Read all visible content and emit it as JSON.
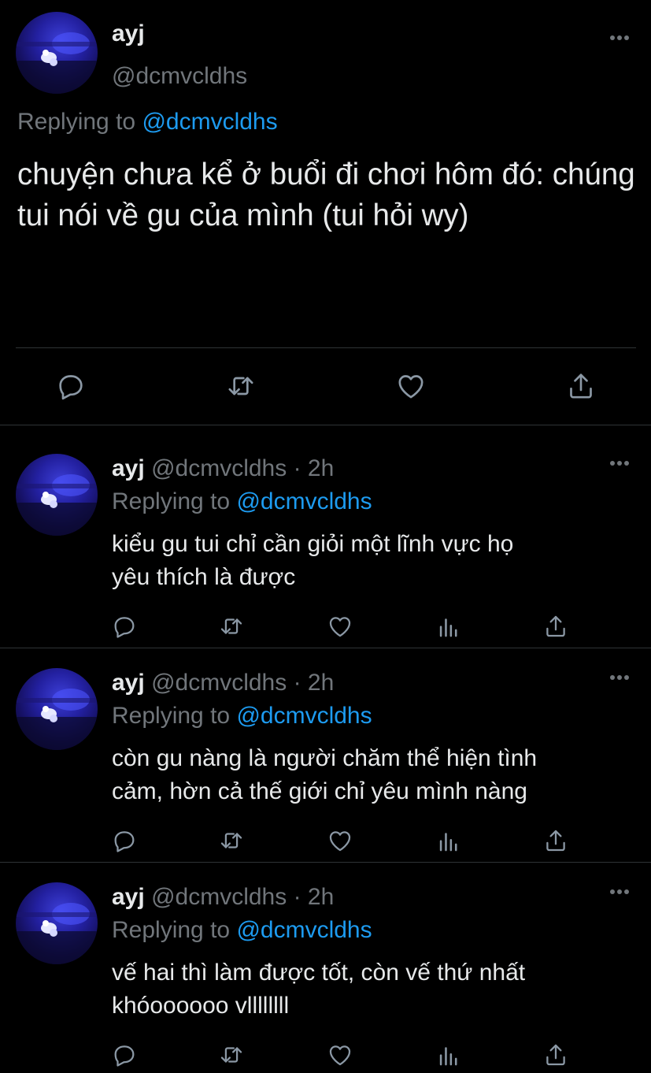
{
  "colors": {
    "background": "#000000",
    "text": "#e7e9ea",
    "muted": "#71767b",
    "accent": "#1d9bf0",
    "divider": "#2f3336"
  },
  "main_tweet": {
    "name": "ayj",
    "handle": "@dcmvcldhs",
    "replying_prefix": "Replying to",
    "replying_mention": "@dcmvcldhs",
    "text": "chuyện chưa kể ở buổi đi chơi hôm đó: chúng tui nói về gu của mình (tui hỏi wy)",
    "actions": [
      "reply-icon",
      "retweet-icon",
      "like-icon",
      "share-icon"
    ]
  },
  "replies": [
    {
      "name": "ayj",
      "handle": "@dcmvcldhs",
      "time": "· 2h",
      "replying_prefix": "Replying to",
      "replying_mention": "@dcmvcldhs",
      "text_line1": "kiểu gu tui chỉ cần giỏi một lĩnh vực họ",
      "text_line2": "yêu thích là được"
    },
    {
      "name": "ayj",
      "handle": "@dcmvcldhs",
      "time": "· 2h",
      "replying_prefix": "Replying to",
      "replying_mention": "@dcmvcldhs",
      "text_line1": "còn gu nàng là người chăm thể hiện tình",
      "text_line2": "cảm, hờn cả thế giới chỉ yêu mình nàng"
    },
    {
      "name": "ayj",
      "handle": "@dcmvcldhs",
      "time": "· 2h",
      "replying_prefix": "Replying to",
      "replying_mention": "@dcmvcldhs",
      "text_line1": "vế hai thì làm được tốt, còn vế thứ nhất",
      "text_line2": "khóoooooo vllllllll"
    }
  ],
  "reply_actions": [
    "reply-icon",
    "retweet-icon",
    "like-icon",
    "analytics-icon",
    "share-icon"
  ]
}
